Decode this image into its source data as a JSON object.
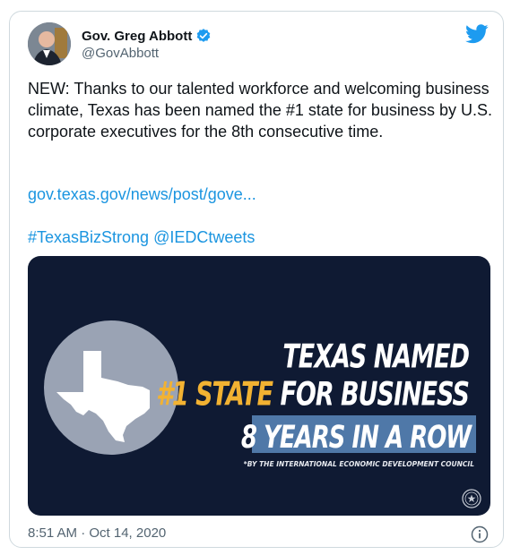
{
  "author": {
    "name": "Gov. Greg Abbott",
    "handle": "@GovAbbott"
  },
  "tweet": {
    "text": "NEW: Thanks to our talented workforce and welcoming business climate, Texas has been named the #1 state for business by U.S. corporate executives for the 8th consecutive time.",
    "link": "gov.texas.gov/news/post/gove...",
    "hashtag": "#TexasBizStrong",
    "mention": "@IEDCtweets",
    "timestamp": "8:51 AM · Oct 14, 2020"
  },
  "media": {
    "line1": "TEXAS NAMED",
    "line2_highlight": "#1 STATE",
    "line2_rest": " FOR BUSINESS",
    "line3": "8 YEARS IN A ROW",
    "footnote": "*BY THE INTERNATIONAL ECONOMIC DEVELOPMENT COUNCIL"
  },
  "icons": {
    "verified": "verified-badge-icon",
    "platform": "twitter-bird-icon",
    "info": "info-icon",
    "state": "texas-map-icon",
    "seal": "texas-seal-icon"
  },
  "colors": {
    "link": "#1b95e0",
    "media_background": "#0f1a33",
    "highlight_gold": "#f2b232",
    "banner_blue": "#4f78a8"
  }
}
